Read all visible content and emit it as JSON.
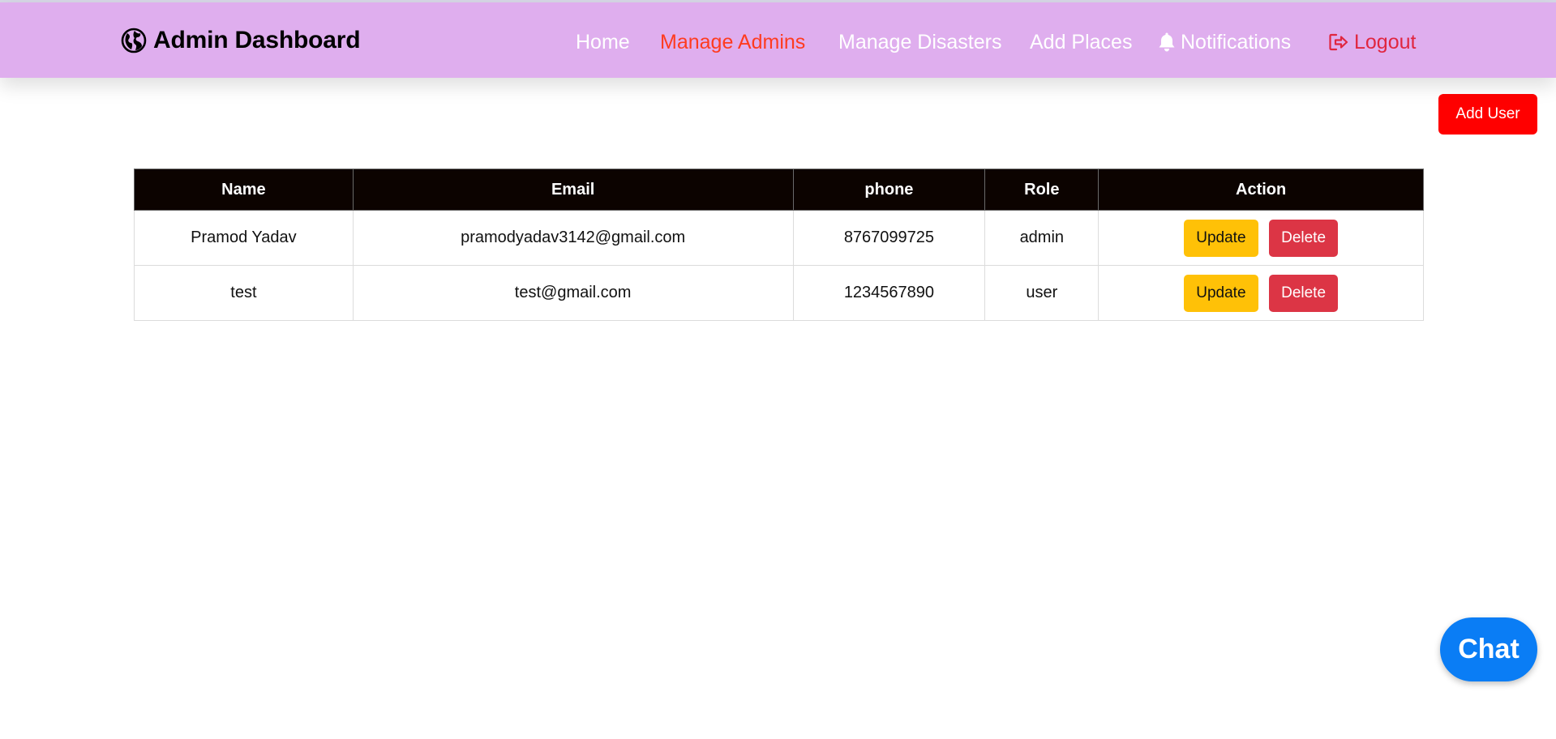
{
  "brand": {
    "title": "Admin Dashboard",
    "icon": "globe-icon"
  },
  "nav": {
    "home": "Home",
    "manage_admins": "Manage Admins",
    "manage_disasters": "Manage Disasters",
    "add_places": "Add Places",
    "notifications": "Notifications",
    "notifications_icon": "bell-icon",
    "logout": "Logout",
    "logout_icon": "logout-icon",
    "active": "Manage Admins"
  },
  "toolbar": {
    "add_user_label": "Add User"
  },
  "table": {
    "headers": [
      "Name",
      "Email",
      "phone",
      "Role",
      "Action"
    ],
    "rows": [
      {
        "name": "Pramod Yadav",
        "email": "pramodyadav3142@gmail.com",
        "phone": "8767099725",
        "role": "admin",
        "update_label": "Update",
        "delete_label": "Delete"
      },
      {
        "name": "test",
        "email": "test@gmail.com",
        "phone": "1234567890",
        "role": "user",
        "update_label": "Update",
        "delete_label": "Delete"
      }
    ]
  },
  "chat": {
    "label": "Chat"
  },
  "colors": {
    "navbar_bg": "#dfaeee",
    "active_link": "#ff3b1f",
    "logout_link": "#e0263f",
    "add_user_bg": "#ff0000",
    "table_header_bg": "#0c0300",
    "update_bg": "#ffc107",
    "delete_bg": "#dc3545",
    "chat_bg": "#0a7df5"
  }
}
